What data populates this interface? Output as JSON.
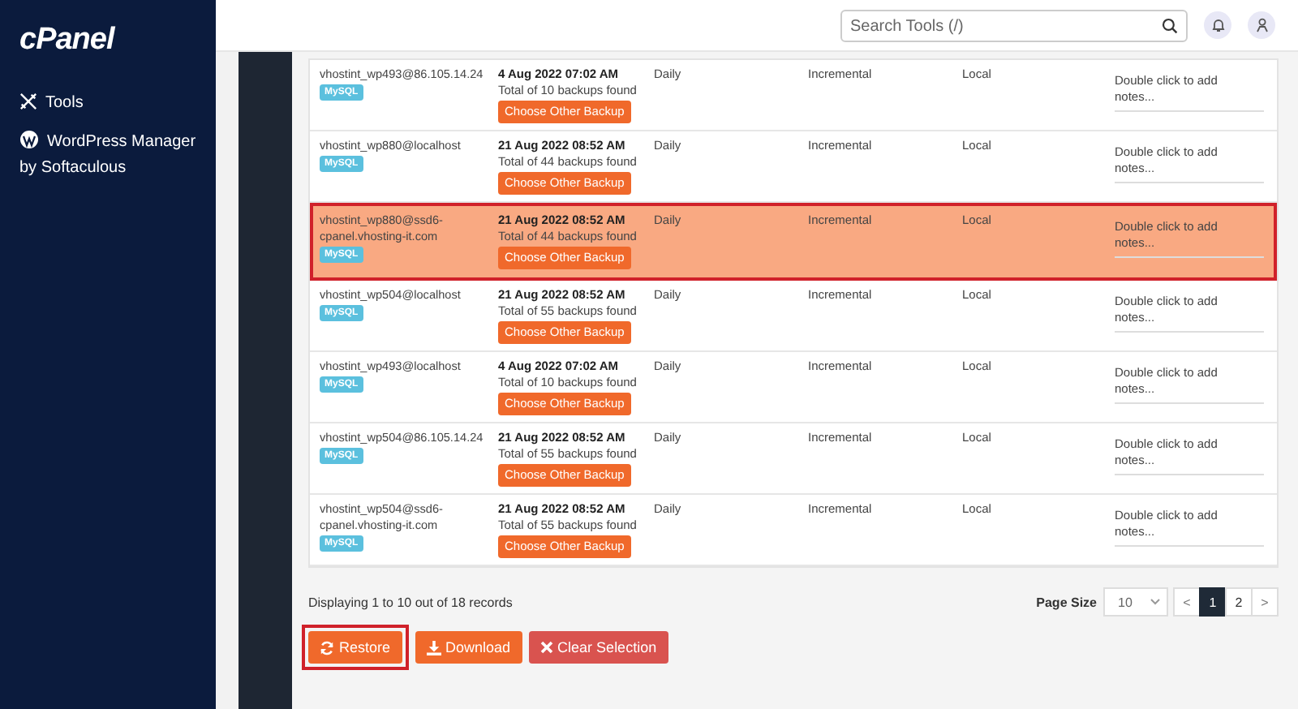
{
  "sidebar": {
    "logo": "cPanel",
    "items": [
      {
        "label": "Tools",
        "kind": "tools"
      },
      {
        "label": "WordPress Manager by Softaculous",
        "kind": "wordpress"
      }
    ]
  },
  "header": {
    "search": {
      "placeholder": "Search Tools (/)"
    }
  },
  "table": {
    "rows": [
      {
        "name": "vhostint_wp493@86.105.14.24",
        "badge": "MySQL",
        "date": "4 Aug 2022 07:02 AM",
        "total": "Total of 10 backups found",
        "action": "Choose Other Backup",
        "frequency": "Daily",
        "type": "Incremental",
        "location": "Local",
        "notes": "Double click to add notes...",
        "selected": false
      },
      {
        "name": "vhostint_wp880@localhost",
        "badge": "MySQL",
        "date": "21 Aug 2022 08:52 AM",
        "total": "Total of 44 backups found",
        "action": "Choose Other Backup",
        "frequency": "Daily",
        "type": "Incremental",
        "location": "Local",
        "notes": "Double click to add notes...",
        "selected": false
      },
      {
        "name": "vhostint_wp880@ssd6-cpanel.vhosting-it.com",
        "badge": "MySQL",
        "date": "21 Aug 2022 08:52 AM",
        "total": "Total of 44 backups found",
        "action": "Choose Other Backup",
        "frequency": "Daily",
        "type": "Incremental",
        "location": "Local",
        "notes": "Double click to add notes...",
        "selected": true
      },
      {
        "name": "vhostint_wp504@localhost",
        "badge": "MySQL",
        "date": "21 Aug 2022 08:52 AM",
        "total": "Total of 55 backups found",
        "action": "Choose Other Backup",
        "frequency": "Daily",
        "type": "Incremental",
        "location": "Local",
        "notes": "Double click to add notes...",
        "selected": false
      },
      {
        "name": "vhostint_wp493@localhost",
        "badge": "MySQL",
        "date": "4 Aug 2022 07:02 AM",
        "total": "Total of 10 backups found",
        "action": "Choose Other Backup",
        "frequency": "Daily",
        "type": "Incremental",
        "location": "Local",
        "notes": "Double click to add notes...",
        "selected": false
      },
      {
        "name": "vhostint_wp504@86.105.14.24",
        "badge": "MySQL",
        "date": "21 Aug 2022 08:52 AM",
        "total": "Total of 55 backups found",
        "action": "Choose Other Backup",
        "frequency": "Daily",
        "type": "Incremental",
        "location": "Local",
        "notes": "Double click to add notes...",
        "selected": false
      },
      {
        "name": "vhostint_wp504@ssd6-cpanel.vhosting-it.com",
        "badge": "MySQL",
        "date": "21 Aug 2022 08:52 AM",
        "total": "Total of 55 backups found",
        "action": "Choose Other Backup",
        "frequency": "Daily",
        "type": "Incremental",
        "location": "Local",
        "notes": "Double click to add notes...",
        "selected": false
      }
    ]
  },
  "footer": {
    "summary": "Displaying 1 to 10 out of 18 records",
    "page_size_label": "Page Size",
    "page_size": "10",
    "pages": [
      {
        "label": "<",
        "kind": "prev",
        "selected": false
      },
      {
        "label": "1",
        "kind": "page",
        "selected": true
      },
      {
        "label": "2",
        "kind": "page",
        "selected": false
      },
      {
        "label": ">",
        "kind": "next",
        "selected": false
      }
    ]
  },
  "actions": [
    {
      "label": "Restore",
      "kind": "restore",
      "outlined": true
    },
    {
      "label": "Download",
      "kind": "download",
      "outlined": false
    },
    {
      "label": "Clear Selection",
      "kind": "clear",
      "outlined": false
    }
  ]
}
